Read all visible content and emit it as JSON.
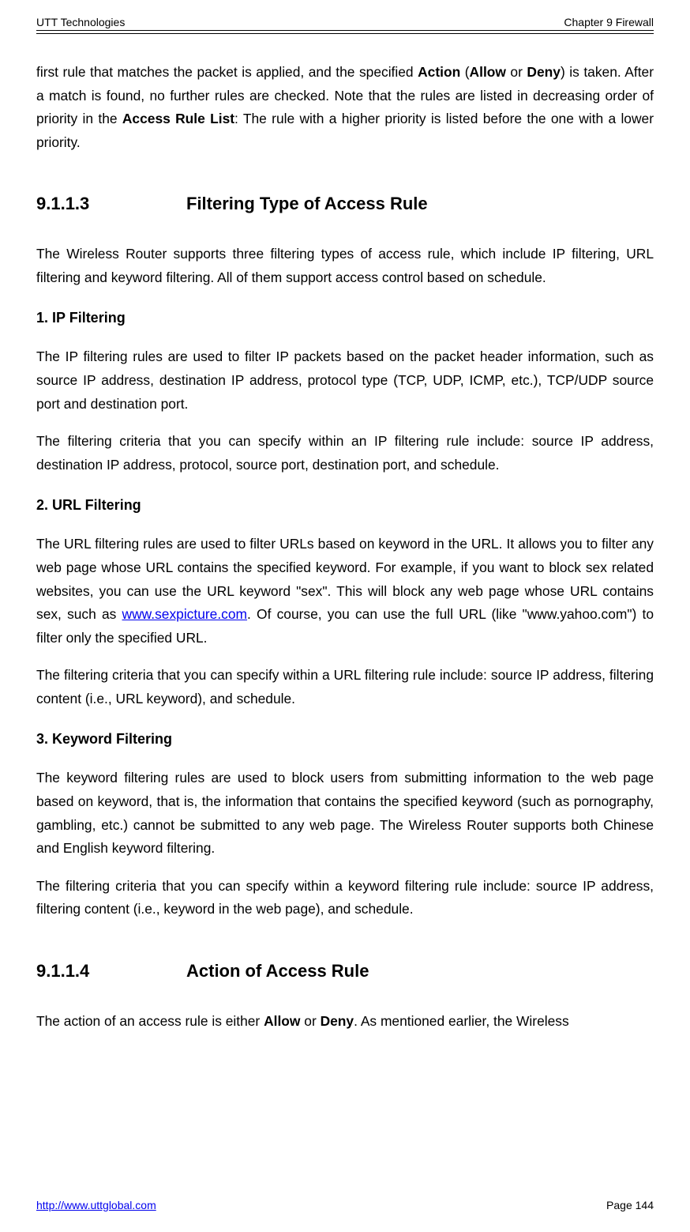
{
  "header": {
    "left": "UTT Technologies",
    "right": "Chapter 9 Firewall"
  },
  "intro_para": "first rule that matches the packet is applied, and the specified Action (Allow or Deny) is taken. After a match is found, no further rules are checked. Note that the rules are listed in decreasing order of priority in the Access Rule List: The rule with a higher priority is listed before the one with a lower priority.",
  "section1": {
    "num": "9.1.1.3",
    "title": "Filtering Type of Access Rule",
    "para": "The Wireless Router supports three filtering types of access rule, which include IP filtering, URL filtering and keyword filtering. All of them support access control based on schedule.",
    "sub1": {
      "title": "1.   IP Filtering",
      "p1": "The IP filtering rules are used to filter IP packets based on the packet header information, such as source IP address, destination IP address, protocol type (TCP, UDP, ICMP, etc.), TCP/UDP source port and destination port.",
      "p2": "The filtering criteria that you can specify within an IP filtering rule include: source IP address, destination IP address, protocol, source port, destination port, and schedule."
    },
    "sub2": {
      "title": "2.   URL Filtering",
      "p1a": "The URL filtering rules are used to filter URLs based on keyword in the URL. It allows you to filter any web page whose URL contains the specified keyword. For example, if you want to block sex related websites, you can use the URL keyword \"sex\". This will block any web page whose URL contains sex, such as ",
      "link": "www.sexpicture.com",
      "p1b": ". Of course, you can use the full URL (like \"www.yahoo.com\") to filter only the specified URL.",
      "p2": "The filtering criteria that you can specify within a URL filtering rule include: source IP address, filtering content (i.e., URL keyword), and schedule."
    },
    "sub3": {
      "title": "3.   Keyword Filtering",
      "p1": "The keyword filtering rules are used to block users from submitting information to the web page based on keyword, that is, the information that contains the specified keyword (such as pornography, gambling, etc.) cannot be submitted to any web page. The Wireless Router supports both Chinese and English keyword filtering.",
      "p2": "The filtering criteria that you can specify within a keyword filtering rule include: source IP address, filtering content (i.e., keyword in the web page), and schedule."
    }
  },
  "section2": {
    "num": "9.1.1.4",
    "title": "Action of Access Rule",
    "para": "The action of an access rule is either Allow or Deny. As mentioned earlier, the Wireless"
  },
  "footer": {
    "url": "http://www.uttglobal.com",
    "page": "Page 144"
  }
}
